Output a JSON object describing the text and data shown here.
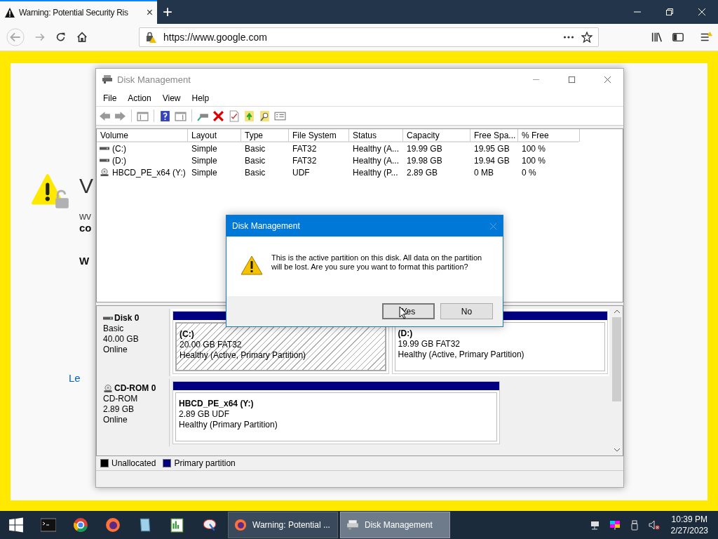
{
  "browser": {
    "tab": {
      "title": "Warning: Potential Security Ris",
      "close": "×"
    },
    "new_tab": "+",
    "address": "https://www.google.com"
  },
  "page": {
    "heading": "V",
    "line": "wv",
    "bold_line": "co",
    "bold_heading": "W",
    "link": "Le"
  },
  "window": {
    "title": "Disk Management",
    "menu": [
      "File",
      "Action",
      "View",
      "Help"
    ],
    "table": {
      "columns": [
        "Volume",
        "Layout",
        "Type",
        "File System",
        "Status",
        "Capacity",
        "Free Spa...",
        "% Free"
      ],
      "rows": [
        {
          "kind": "disk",
          "cells": [
            "(C:)",
            "Simple",
            "Basic",
            "FAT32",
            "Healthy (A...",
            "19.99 GB",
            "19.95 GB",
            "100 %"
          ]
        },
        {
          "kind": "disk",
          "cells": [
            "(D:)",
            "Simple",
            "Basic",
            "FAT32",
            "Healthy (A...",
            "19.98 GB",
            "19.94 GB",
            "100 %"
          ]
        },
        {
          "kind": "cdrom",
          "cells": [
            "HBCD_PE_x64 (Y:)",
            "Simple",
            "Basic",
            "UDF",
            "Healthy (P...",
            "2.89 GB",
            "0 MB",
            "0 %"
          ]
        }
      ]
    },
    "disks": [
      {
        "kind": "disk",
        "name": "Disk 0",
        "type": "Basic",
        "size": "40.00 GB",
        "status": "Online",
        "partitions": [
          {
            "label": "(C:)",
            "size": "20.00 GB FAT32",
            "health": "Healthy (Active, Primary Partition)",
            "selected": true
          },
          {
            "label": "(D:)",
            "size": "19.99 GB FAT32",
            "health": "Healthy (Active, Primary Partition)",
            "selected": false
          }
        ]
      },
      {
        "kind": "cdrom",
        "name": "CD-ROM 0",
        "type": "CD-ROM",
        "size": "2.89 GB",
        "status": "Online",
        "partitions": [
          {
            "label": "HBCD_PE_x64  (Y:)",
            "size": "2.89 GB UDF",
            "health": "Healthy (Primary Partition)",
            "selected": false
          }
        ]
      }
    ],
    "legend": [
      {
        "label": "Unallocated",
        "color": "#000000"
      },
      {
        "label": "Primary partition",
        "color": "#000080"
      }
    ]
  },
  "dialog": {
    "title": "Disk Management",
    "message": "This is the active partition on this disk. All data on the partition will be lost. Are you sure you want to format this partition?",
    "buttons": [
      {
        "label": "Yes",
        "focused": true
      },
      {
        "label": "No",
        "focused": false
      }
    ]
  },
  "taskbar": {
    "tasks": [
      {
        "kind": "firefox",
        "label": "Warning: Potential ...",
        "selected": false
      },
      {
        "kind": "disk",
        "label": "Disk Management",
        "selected": true
      }
    ],
    "time": "10:39 PM",
    "date": "2/27/2023"
  }
}
